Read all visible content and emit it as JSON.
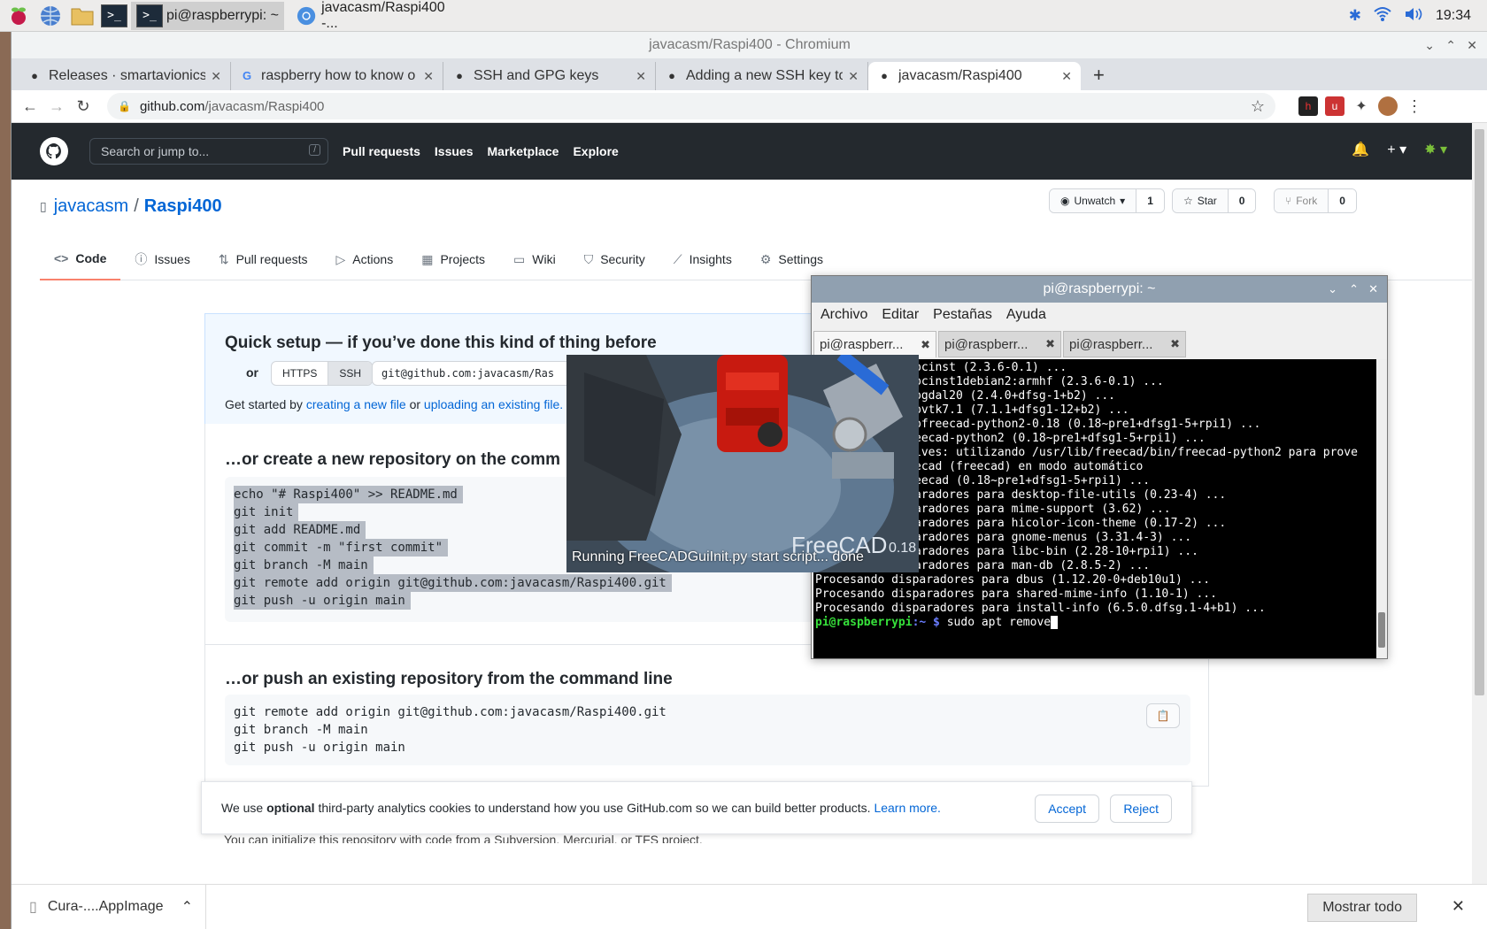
{
  "taskbar": {
    "tasks": [
      {
        "label": "pi@raspberrypi: ~"
      },
      {
        "label": "javacasm/Raspi400 -..."
      }
    ],
    "clock": "19:34"
  },
  "browser": {
    "window_title": "javacasm/Raspi400 - Chromium",
    "tabs": [
      {
        "title": "Releases · smartavionics",
        "favicon": "github-icon"
      },
      {
        "title": "raspberry how to know o",
        "favicon": "google-icon"
      },
      {
        "title": "SSH and GPG keys",
        "favicon": "github-icon"
      },
      {
        "title": "Adding a new SSH key to",
        "favicon": "github-icon"
      },
      {
        "title": "javacasm/Raspi400",
        "favicon": "github-icon"
      }
    ],
    "url_domain": "github.com",
    "url_path": "/javacasm/Raspi400"
  },
  "github": {
    "search_placeholder": "Search or jump to...",
    "search_shortcut": "/",
    "nav": [
      "Pull requests",
      "Issues",
      "Marketplace",
      "Explore"
    ],
    "owner": "javacasm",
    "separator": "/",
    "repo": "Raspi400",
    "watch": {
      "label": "Unwatch",
      "count": "1"
    },
    "star": {
      "label": "Star",
      "count": "0"
    },
    "fork": {
      "label": "Fork",
      "count": "0"
    },
    "repo_tabs": [
      "Code",
      "Issues",
      "Pull requests",
      "Actions",
      "Projects",
      "Wiki",
      "Security",
      "Insights",
      "Settings"
    ],
    "quick_setup": {
      "title": "Quick setup — if you’ve done this kind of thing before",
      "or": "or",
      "https": "HTTPS",
      "ssh": "SSH",
      "clone_url": "git@github.com:javacasm/Ras",
      "get_started_prefix": "Get started by",
      "link_create": "creating a new file",
      "or_text": "or",
      "link_upload": "uploading an existing file."
    },
    "create_section": {
      "title": "…or create a new repository on the comm",
      "lines": [
        "echo \"# Raspi400\" >> README.md",
        "git init",
        "git add README.md",
        "git commit -m \"first commit\"",
        "git branch -M main",
        "git remote add origin git@github.com:javacasm/Raspi400.git",
        "git push -u origin main"
      ]
    },
    "push_section": {
      "title": "…or push an existing repository from the command line",
      "lines": [
        "git remote add origin git@github.com:javacasm/Raspi400.git",
        "git branch -M main",
        "git push -u origin main"
      ]
    },
    "hidden_line": "You can initialize this repository with code from a Subversion, Mercurial, or TFS project.",
    "cookie": {
      "pre": "We use",
      "bold": "optional",
      "post": "third-party analytics cookies to understand how you use GitHub.com so we can build better products.",
      "link": "Learn more.",
      "accept": "Accept",
      "reject": "Reject"
    }
  },
  "downloads": {
    "file": "Cura-....AppImage",
    "show_all": "Mostrar todo"
  },
  "terminal": {
    "title": "pi@raspberrypi: ~",
    "menu": [
      "Archivo",
      "Editar",
      "Pestañas",
      "Ayuda"
    ],
    "tabs": [
      "pi@raspberr...",
      "pi@raspberr...",
      "pi@raspberr..."
    ],
    "lines": [
      "bcinst (2.3.6-0.1) ...",
      "bcinst1debian2:armhf (2.3.6-0.1) ...",
      "bgdal20 (2.4.0+dfsg-1+b2) ...",
      "bvtk7.1 (7.1.1+dfsg1-12+b2) ...",
      "bfreecad-python2-0.18 (0.18~pre1+dfsg1-5+rpi1) ...",
      "eecad-python2 (0.18~pre1+dfsg1-5+rpi1) ...",
      "ives: utilizando /usr/lib/freecad/bin/freecad-python2 para prove",
      "ecad (freecad) en modo automático",
      "eecad (0.18~pre1+dfsg1-5+rpi1) ...",
      "aradores para desktop-file-utils (0.23-4) ...",
      "aradores para mime-support (3.62) ...",
      "aradores para hicolor-icon-theme (0.17-2) ...",
      "aradores para gnome-menus (3.31.4-3) ...",
      "aradores para libc-bin (2.28-10+rpi1) ...",
      "aradores para man-db (2.8.5-2) ..."
    ],
    "full_lines": [
      "Procesando disparadores para dbus (1.12.20-0+deb10u1) ...",
      "Procesando disparadores para shared-mime-info (1.10-1) ...",
      "Procesando disparadores para install-info (6.5.0.dfsg.1-4+b1) ..."
    ],
    "prompt_user": "pi@raspberrypi",
    "prompt_path": ":~ $",
    "command": "sudo apt remove"
  },
  "splash": {
    "name": "FreeCAD",
    "version": "0.18",
    "status": "Running FreeCADGuiInit.py start script... done"
  }
}
